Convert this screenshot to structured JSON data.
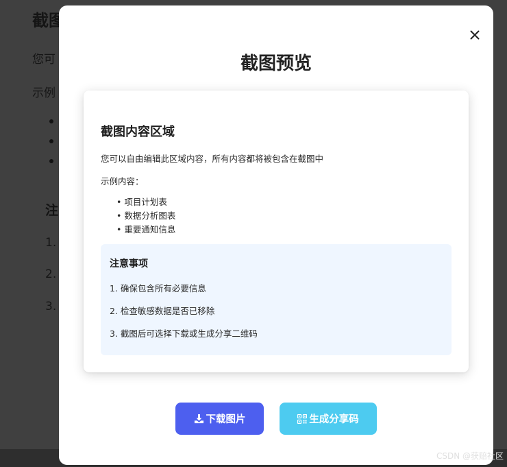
{
  "background": {
    "title": "截图",
    "line1": "您可",
    "line2": "示例",
    "note_title": "注",
    "nums": [
      "1.",
      "2.",
      "3."
    ]
  },
  "modal": {
    "title": "截图预览",
    "close_icon": "close-icon"
  },
  "card": {
    "title": "截图内容区域",
    "description": "您可以自由编辑此区域内容，所有内容都将被包含在截图中",
    "example_label": "示例内容：",
    "list": [
      "项目计划表",
      "数据分析图表",
      "重要通知信息"
    ],
    "note": {
      "title": "注意事项",
      "items": [
        "1. 确保包含所有必要信息",
        "2. 检查敏感数据是否已移除",
        "3. 截图后可选择下载或生成分享二维码"
      ]
    }
  },
  "buttons": {
    "download_label": "下载图片",
    "download_icon": "download-icon",
    "qr_label": "生成分享码",
    "qr_icon": "qr-code-icon"
  },
  "colors": {
    "primary": "#4d5fef",
    "secondary": "#4dcbf0",
    "note_bg": "#eff6ff"
  },
  "watermark": "CSDN @获赔社区"
}
